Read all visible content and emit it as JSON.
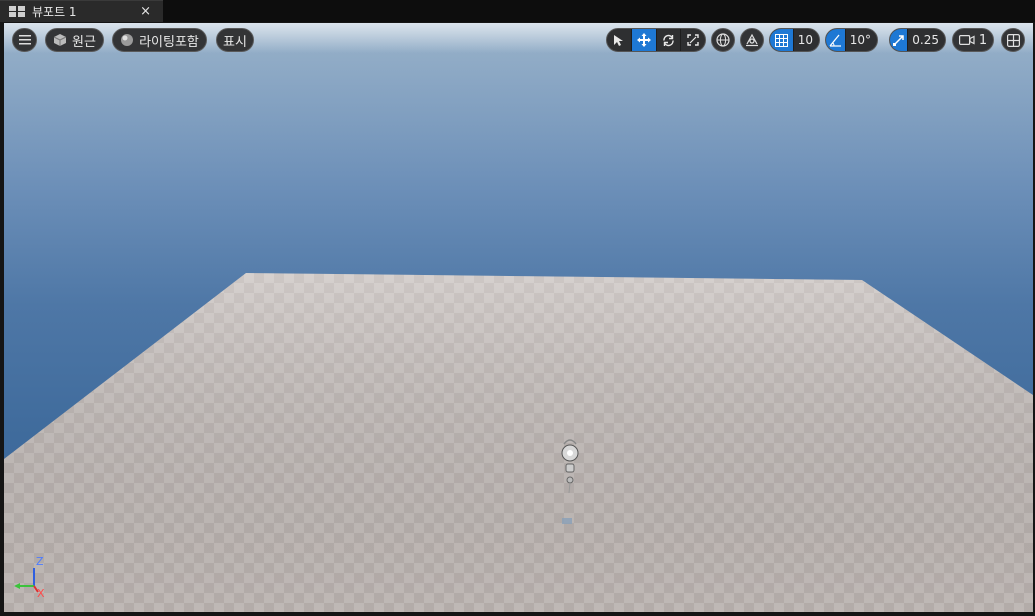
{
  "tab": {
    "title": "뷰포트 1",
    "close": "×"
  },
  "toolbar": {
    "menu_icon": "hamburger-menu-icon",
    "perspective_label": "원근",
    "lighting_label": "라이팅포함",
    "show_label": "표시",
    "grid_snap_value": "10",
    "rotation_snap_value": "10°",
    "scale_snap_value": "0.25",
    "camera_speed_value": "1"
  },
  "axis_labels": {
    "z": "Z",
    "x": "X"
  },
  "colors": {
    "accent": "#1e78d4",
    "toolbar_bg": "#333436",
    "sky_top": "#9ab3ca",
    "sky_bottom": "#3a6597"
  }
}
